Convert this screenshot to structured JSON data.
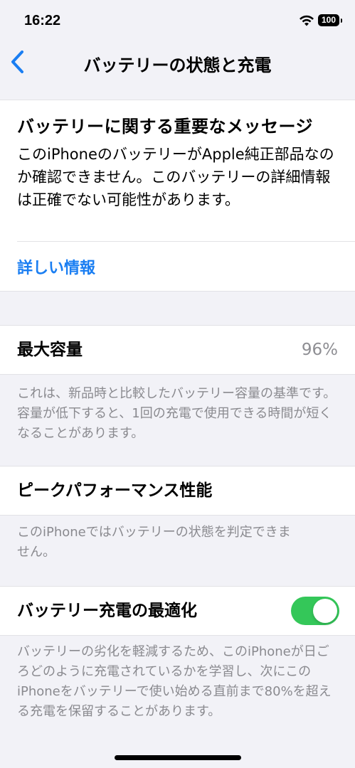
{
  "status_bar": {
    "time": "16:22",
    "battery_level": "100",
    "wifi_icon": "wifi-icon"
  },
  "nav": {
    "back_icon": "chevron-left-icon",
    "title": "バッテリーの状態と充電"
  },
  "important_message": {
    "title": "バッテリーに関する重要なメッセージ",
    "body": "このiPhoneのバッテリーがApple純正部品なのか確認できません。このバッテリーの詳細情報は正確でない可能性があります。",
    "link": "詳しい情報"
  },
  "max_capacity": {
    "label": "最大容量",
    "value": "96%",
    "footnote": "これは、新品時と比較したバッテリー容量の基準です。容量が低下すると、1回の充電で使用できる時間が短くなることがあります。"
  },
  "peak_performance": {
    "label": "ピークパフォーマンス性能",
    "footnote": "このiPhoneではバッテリーの状態を判定できません。"
  },
  "optimized_charging": {
    "label": "バッテリー充電の最適化",
    "enabled": true,
    "footnote": "バッテリーの劣化を軽減するため、このiPhoneが日ごろどのように充電されているかを学習し、次にこのiPhoneをバッテリーで使い始める直前まで80%を超える充電を保留することがあります。"
  },
  "colors": {
    "accent": "#1a7ef2",
    "toggle_on": "#34c759",
    "background": "#f2f2f7",
    "secondary_text": "#8a8a8f"
  }
}
